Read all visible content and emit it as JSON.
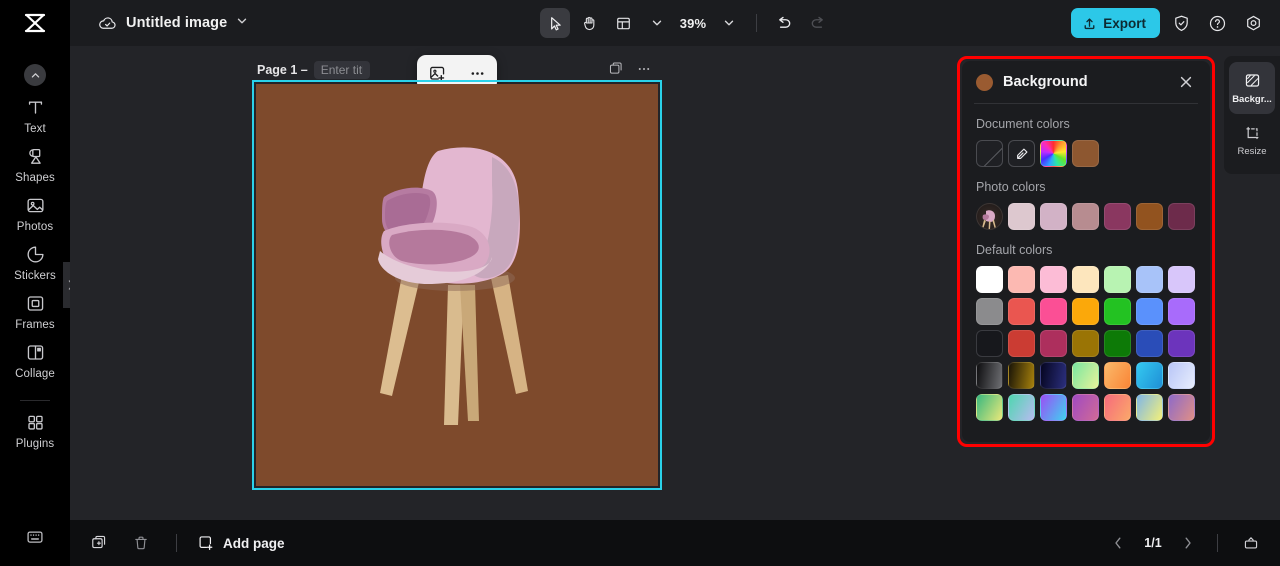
{
  "app": {
    "logo_icon": "capcut-logo-icon",
    "cloud_icon": "cloud-saved-icon",
    "doc_title": "Untitled image",
    "title_chevron_icon": "chevron-down-icon"
  },
  "toolbar": {
    "select_icon": "cursor-select-icon",
    "hand_icon": "hand-pan-icon",
    "layout_icon": "layout-grid-icon",
    "layout_chevron_icon": "chevron-down-icon",
    "zoom_value": "39%",
    "zoom_chevron_icon": "chevron-down-icon",
    "undo_icon": "undo-arrow-icon",
    "redo_icon": "redo-arrow-icon",
    "export_label": "Export",
    "export_icon": "upload-icon",
    "export_color": "#2cc8e8",
    "shield_icon": "shield-check-icon",
    "help_icon": "question-circle-icon",
    "settings_icon": "gear-hex-icon"
  },
  "sidebar": {
    "collapse_icon": "chevron-up-icon",
    "items": [
      {
        "label": "Text",
        "icon": "text-t-icon"
      },
      {
        "label": "Shapes",
        "icon": "shapes-icon"
      },
      {
        "label": "Photos",
        "icon": "photo-image-icon"
      },
      {
        "label": "Stickers",
        "icon": "sticker-icon"
      },
      {
        "label": "Frames",
        "icon": "frame-square-icon"
      },
      {
        "label": "Collage",
        "icon": "collage-layout-icon"
      },
      {
        "label": "Plugins",
        "icon": "plugins-grid-icon"
      }
    ],
    "bottom_icon": "keyboard-shortcuts-icon",
    "expand_tab_icon": "chevron-right-icon"
  },
  "canvas": {
    "page_label": "Page 1 –",
    "page_title_value": "",
    "page_title_placeholder": "Enter title",
    "float_toolbar": {
      "replace_image_icon": "add-image-icon",
      "more_icon": "ellipsis-horizontal-icon"
    },
    "page_icons": {
      "duplicate_icon": "duplicate-page-icon",
      "more_icon": "ellipsis-horizontal-icon"
    },
    "selection_color": "#2ad2ea",
    "artboard_background": "#7e4a2c",
    "artwork": {
      "name": "pink-armchair-photo",
      "seat_color": "#d9a6c0",
      "seat_shadow_color": "#8e4a72",
      "back_color": "#e6bcd4",
      "leg_color": "#d8b98c"
    }
  },
  "background_panel": {
    "highlight_color": "#ff0000",
    "title": "Background",
    "swatch_preview_color": "#9a5b31",
    "close_icon": "close-x-icon",
    "sections": [
      {
        "title": "Document colors",
        "swatches": [
          {
            "name": "no-color",
            "type": "none",
            "color": "transparent"
          },
          {
            "name": "eyedropper",
            "type": "picker",
            "color": "transparent"
          },
          {
            "name": "color-wheel",
            "type": "wheel",
            "color": "rainbow"
          },
          {
            "name": "brown-swatch",
            "type": "solid",
            "color": "#8d5730"
          }
        ]
      },
      {
        "title": "Photo colors",
        "swatches": [
          {
            "name": "photo-thumbnail",
            "type": "thumb",
            "color": "#3b2e2a"
          },
          {
            "name": "light-pink-gray",
            "type": "solid",
            "color": "#ddc8cf"
          },
          {
            "name": "dusty-pink",
            "type": "solid",
            "color": "#d2b2c6"
          },
          {
            "name": "rose-mauve",
            "type": "solid",
            "color": "#b78c90"
          },
          {
            "name": "plum",
            "type": "solid",
            "color": "#8a3760"
          },
          {
            "name": "brown",
            "type": "solid",
            "color": "#92531f"
          },
          {
            "name": "dark-plum",
            "type": "solid",
            "color": "#6d2b4b"
          }
        ]
      }
    ],
    "default_colors": {
      "title": "Default colors",
      "rows": [
        [
          {
            "name": "white",
            "type": "solid",
            "color": "#ffffff"
          },
          {
            "name": "light-salmon",
            "type": "solid",
            "color": "#fcb9b2"
          },
          {
            "name": "light-pink",
            "type": "solid",
            "color": "#fcbcd6"
          },
          {
            "name": "light-cream",
            "type": "solid",
            "color": "#fde6bd"
          },
          {
            "name": "light-green",
            "type": "solid",
            "color": "#b8f3b2"
          },
          {
            "name": "light-blue",
            "type": "solid",
            "color": "#a8c3f9"
          },
          {
            "name": "light-lavender",
            "type": "solid",
            "color": "#d8c6fa"
          }
        ],
        [
          {
            "name": "gray",
            "type": "solid",
            "color": "#8b8b8d"
          },
          {
            "name": "coral-red",
            "type": "solid",
            "color": "#ea5650"
          },
          {
            "name": "hot-pink",
            "type": "solid",
            "color": "#fb4f95"
          },
          {
            "name": "amber",
            "type": "solid",
            "color": "#fba80a"
          },
          {
            "name": "green",
            "type": "solid",
            "color": "#23c222"
          },
          {
            "name": "blue",
            "type": "solid",
            "color": "#5a91fc"
          },
          {
            "name": "purple",
            "type": "solid",
            "color": "#a86bfb"
          }
        ],
        [
          {
            "name": "black",
            "type": "solid",
            "color": "#17181c"
          },
          {
            "name": "brick-red",
            "type": "solid",
            "color": "#cb3c33"
          },
          {
            "name": "crimson",
            "type": "solid",
            "color": "#ad2f5d"
          },
          {
            "name": "dark-gold",
            "type": "solid",
            "color": "#9a7405"
          },
          {
            "name": "dark-green",
            "type": "solid",
            "color": "#0d7a07"
          },
          {
            "name": "royal-blue",
            "type": "solid",
            "color": "#2a4db8"
          },
          {
            "name": "violet",
            "type": "solid",
            "color": "#6c34bc"
          }
        ],
        [
          {
            "name": "gradient-black-gray",
            "type": "gradient",
            "color": "linear-gradient(100deg,#0d0d0f,#6f7074)"
          },
          {
            "name": "gradient-dark-gold",
            "type": "gradient",
            "color": "linear-gradient(100deg,#191407,#a8820c)"
          },
          {
            "name": "gradient-navy",
            "type": "gradient",
            "color": "linear-gradient(100deg,#05051f,#2b2f7e)"
          },
          {
            "name": "gradient-green-yellow",
            "type": "gradient",
            "color": "linear-gradient(120deg,#7ae6a1,#e8f39a)"
          },
          {
            "name": "gradient-orange",
            "type": "gradient",
            "color": "linear-gradient(120deg,#fbb96a,#f98536)"
          },
          {
            "name": "gradient-cyan-blue",
            "type": "gradient",
            "color": "linear-gradient(120deg,#34c9f0,#1f8fd6)"
          },
          {
            "name": "gradient-lavender-white",
            "type": "gradient",
            "color": "linear-gradient(120deg,#b9c6f7,#e7edfd)"
          }
        ],
        [
          {
            "name": "gradient-green-yellow-2",
            "type": "gradient",
            "color": "linear-gradient(120deg,#3ab87f,#e9e87a)"
          },
          {
            "name": "gradient-teal-violet",
            "type": "gradient",
            "color": "linear-gradient(120deg,#4fd6b0,#b8bbf0)"
          },
          {
            "name": "gradient-purple-cyan",
            "type": "gradient",
            "color": "linear-gradient(120deg,#9b4ef5,#3fd2f0)"
          },
          {
            "name": "gradient-magenta-violet",
            "type": "gradient",
            "color": "linear-gradient(120deg,#a04ac2,#d06a96)"
          },
          {
            "name": "gradient-pink-orange",
            "type": "gradient",
            "color": "linear-gradient(120deg,#f66b7c,#fba86a)"
          },
          {
            "name": "gradient-blue-yellow",
            "type": "gradient",
            "color": "linear-gradient(120deg,#7fb6e8,#f3f07a)"
          },
          {
            "name": "gradient-rose-violet",
            "type": "gradient",
            "color": "linear-gradient(120deg,#8e6ac8,#e08f86)"
          }
        ]
      ]
    }
  },
  "right_rail": {
    "items": [
      {
        "label": "Backgr...",
        "icon": "background-pattern-icon",
        "active": true
      },
      {
        "label": "Resize",
        "icon": "resize-crop-icon",
        "active": false
      }
    ]
  },
  "bottom_bar": {
    "duplicate_icon": "duplicate-icon",
    "delete_icon": "trash-icon",
    "add_page_label": "Add page",
    "add_page_icon": "add-page-icon",
    "prev_icon": "chevron-left-icon",
    "next_icon": "chevron-right-icon",
    "page_count": "1/1",
    "presentation_icon": "presentation-icon"
  }
}
